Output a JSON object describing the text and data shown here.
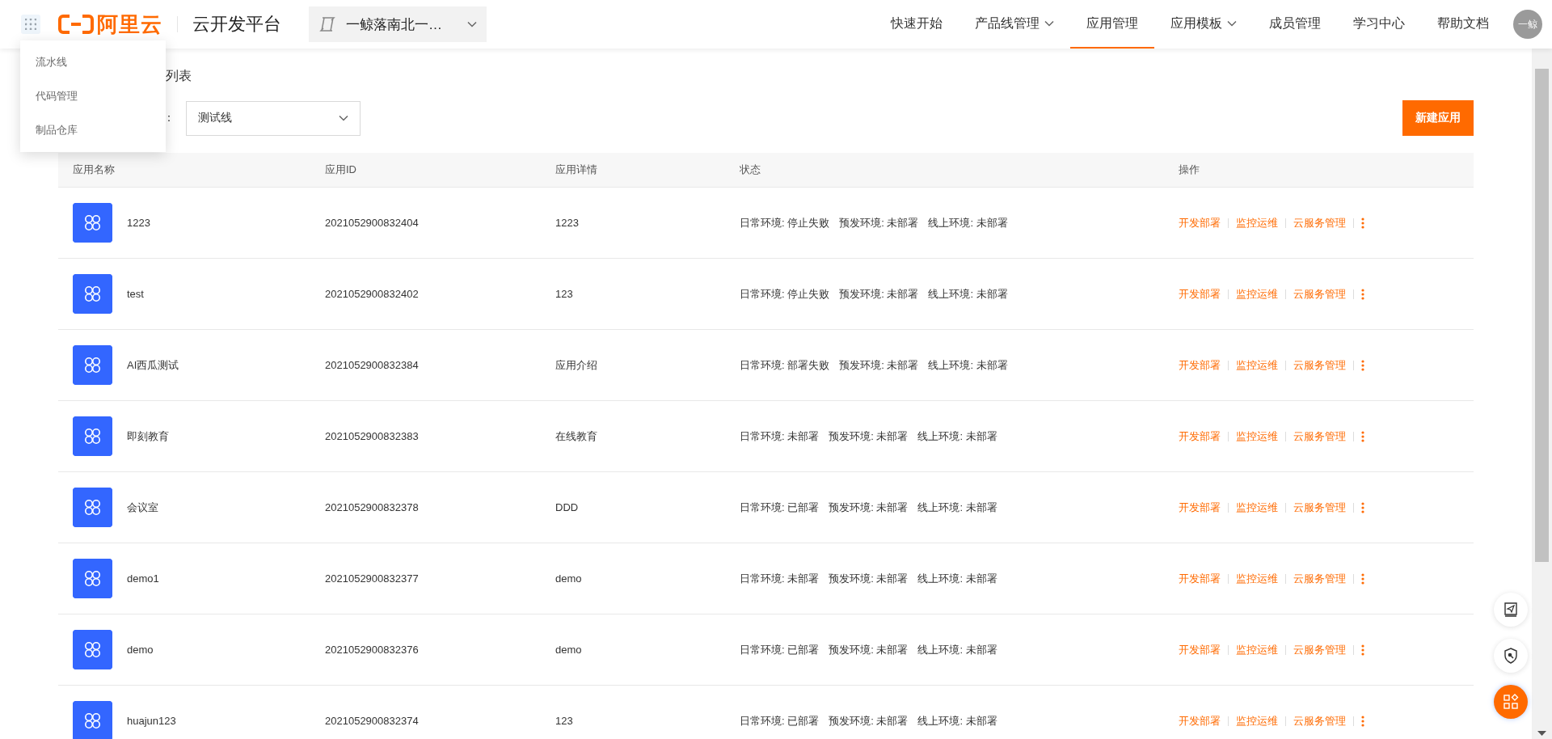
{
  "header": {
    "brand": "阿里云",
    "platform": "云开发平台",
    "project": "一鲸落南北一…",
    "nav": [
      {
        "label": "快速开始",
        "dropdown": false,
        "selected": false
      },
      {
        "label": "产品线管理",
        "dropdown": true,
        "selected": false
      },
      {
        "label": "应用管理",
        "dropdown": false,
        "selected": true
      },
      {
        "label": "应用模板",
        "dropdown": true,
        "selected": false
      },
      {
        "label": "成员管理",
        "dropdown": false,
        "selected": false
      },
      {
        "label": "学习中心",
        "dropdown": false,
        "selected": false
      },
      {
        "label": "帮助文档",
        "dropdown": false,
        "selected": false
      }
    ],
    "avatar": "一鲸"
  },
  "app_menu": [
    "流水线",
    "代码管理",
    "制品仓库"
  ],
  "page_title": "列表",
  "filter": {
    "label": "：",
    "value": "测试线"
  },
  "new_button": "新建应用",
  "table": {
    "columns": [
      "应用名称",
      "应用ID",
      "应用详情",
      "状态",
      "操作"
    ],
    "rows": [
      {
        "name": "1223",
        "id": "2021052900832404",
        "detail": "1223",
        "status": [
          "日常环境: 停止失败",
          "预发环境: 未部署",
          "线上环境: 未部署"
        ],
        "actions": [
          "开发部署",
          "监控运维",
          "云服务管理"
        ]
      },
      {
        "name": "test",
        "id": "2021052900832402",
        "detail": "123",
        "status": [
          "日常环境: 停止失败",
          "预发环境: 未部署",
          "线上环境: 未部署"
        ],
        "actions": [
          "开发部署",
          "监控运维",
          "云服务管理"
        ]
      },
      {
        "name": "AI西瓜测试",
        "id": "2021052900832384",
        "detail": "应用介绍",
        "status": [
          "日常环境: 部署失败",
          "预发环境: 未部署",
          "线上环境: 未部署"
        ],
        "actions": [
          "开发部署",
          "监控运维",
          "云服务管理"
        ]
      },
      {
        "name": "即刻教育",
        "id": "2021052900832383",
        "detail": "在线教育",
        "status": [
          "日常环境: 未部署",
          "预发环境: 未部署",
          "线上环境: 未部署"
        ],
        "actions": [
          "开发部署",
          "监控运维",
          "云服务管理"
        ]
      },
      {
        "name": "会议室",
        "id": "2021052900832378",
        "detail": "DDD",
        "status": [
          "日常环境: 已部署",
          "预发环境: 未部署",
          "线上环境: 未部署"
        ],
        "actions": [
          "开发部署",
          "监控运维",
          "云服务管理"
        ]
      },
      {
        "name": "demo1",
        "id": "2021052900832377",
        "detail": "demo",
        "status": [
          "日常环境: 未部署",
          "预发环境: 未部署",
          "线上环境: 未部署"
        ],
        "actions": [
          "开发部署",
          "监控运维",
          "云服务管理"
        ]
      },
      {
        "name": "demo",
        "id": "2021052900832376",
        "detail": "demo",
        "status": [
          "日常环境: 已部署",
          "预发环境: 未部署",
          "线上环境: 未部署"
        ],
        "actions": [
          "开发部署",
          "监控运维",
          "云服务管理"
        ]
      },
      {
        "name": "huajun123",
        "id": "2021052900832374",
        "detail": "123",
        "status": [
          "日常环境: 已部署",
          "预发环境: 未部署",
          "线上环境: 未部署"
        ],
        "actions": [
          "开发部署",
          "监控运维",
          "云服务管理"
        ]
      }
    ]
  }
}
